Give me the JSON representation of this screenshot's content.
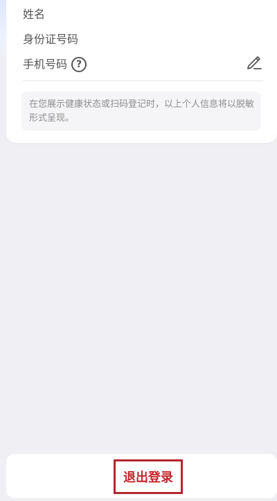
{
  "profile": {
    "name_label": "姓名",
    "id_label": "身份证号码",
    "phone_label": "手机号码",
    "help_glyph": "?",
    "notice_text": "在您展示健康状态或扫码登记时，以上个人信息将以脱敏形式呈现。"
  },
  "footer": {
    "logout_label": "退出登录"
  },
  "colors": {
    "background": "#efeff4",
    "card": "#ffffff",
    "logout_text": "#c5262d",
    "logout_border": "#b3262e"
  },
  "icons": {
    "help": "question-circle-icon",
    "edit": "pencil-icon"
  }
}
